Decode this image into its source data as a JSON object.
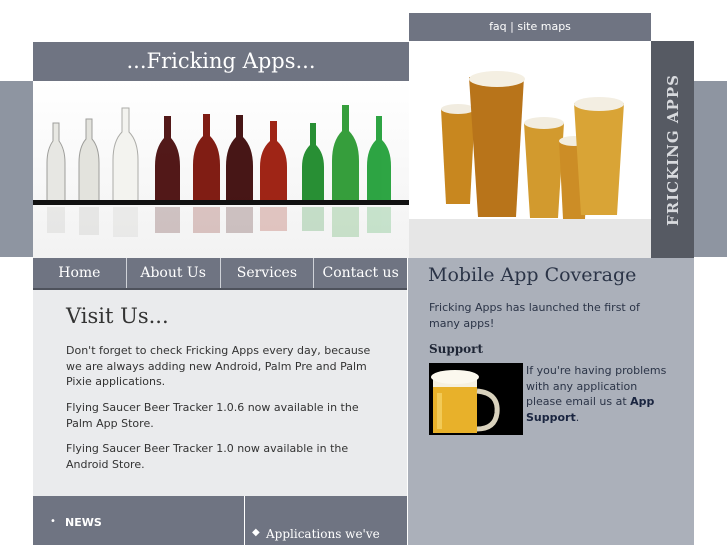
{
  "top_links": {
    "faq": "faq",
    "separator": " | ",
    "site_maps": "site maps"
  },
  "site_title": "...Fricking Apps...",
  "vertical_banner": "FRICKING APPS",
  "nav": {
    "home": "Home",
    "about": "About Us",
    "services": "Services",
    "contact": "Contact us"
  },
  "main": {
    "heading": "Visit Us...",
    "paragraphs": [
      "Don't forget to check Fricking Apps every day, because we are always adding new Android, Palm Pre and Palm Pixie applications.",
      "Flying Saucer Beer Tracker 1.0.6 now available in the Palm App Store.",
      "Flying Saucer Beer Tracker 1.0 now available in the Android Store."
    ]
  },
  "footer": {
    "news_bullet": "•",
    "news_label": "NEWS",
    "apps_bullet": "◆",
    "apps_label": "Applications we've"
  },
  "sidebar": {
    "heading": "Mobile App Coverage",
    "intro": "Fricking Apps has launched the first of many apps!",
    "support_heading": "Support",
    "support_text": "If you're having problems with any application please email us at ",
    "support_link": "App Support",
    "support_end": "."
  },
  "colors": {
    "slate": "#6f7482",
    "sidebar": "#abb0ba",
    "banner": "#565a63",
    "content": "#eaebed"
  }
}
